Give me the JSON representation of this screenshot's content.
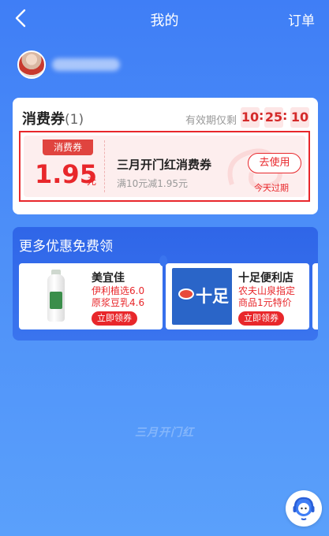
{
  "header": {
    "back_icon": "chevron-left-icon",
    "title": "我的",
    "orders_label": "订单"
  },
  "profile": {
    "avatar": "user-avatar",
    "username_obscured": true
  },
  "coupons": {
    "title": "消费券",
    "count": "(1)",
    "validity_label": "有效期仅剩",
    "timer": {
      "hours": "10",
      "minutes": "25",
      "seconds": "10",
      "separator": ":"
    },
    "items": [
      {
        "tag": "消费券",
        "amount": "1.95",
        "unit": "元",
        "name": "三月开门红消费券",
        "rule": "满10元减1.95元",
        "action": "去使用",
        "expire_note": "今天过期",
        "highlight_color": "#e8272b"
      }
    ]
  },
  "more_offers": {
    "title": "更多优惠免费领",
    "offers": [
      {
        "shop": "美宜佳",
        "desc_line1": "伊利植选6.0",
        "desc_line2": "原浆豆乳4.6",
        "action": "立即领券",
        "image": "soy-milk-bottle"
      },
      {
        "shop": "十足便利店",
        "desc_line1": "农夫山泉指定",
        "desc_line2": "商品1元特价",
        "action": "立即领券",
        "image": "shiz-store-logo",
        "logo_text": "十足"
      }
    ]
  },
  "footer": {
    "brand": "三月开门红"
  },
  "service": {
    "icon": "customer-service-icon"
  },
  "colors": {
    "primary_blue": "#3f7ef6",
    "accent_red": "#e8272b",
    "panel_blue": "#2f66e8"
  }
}
